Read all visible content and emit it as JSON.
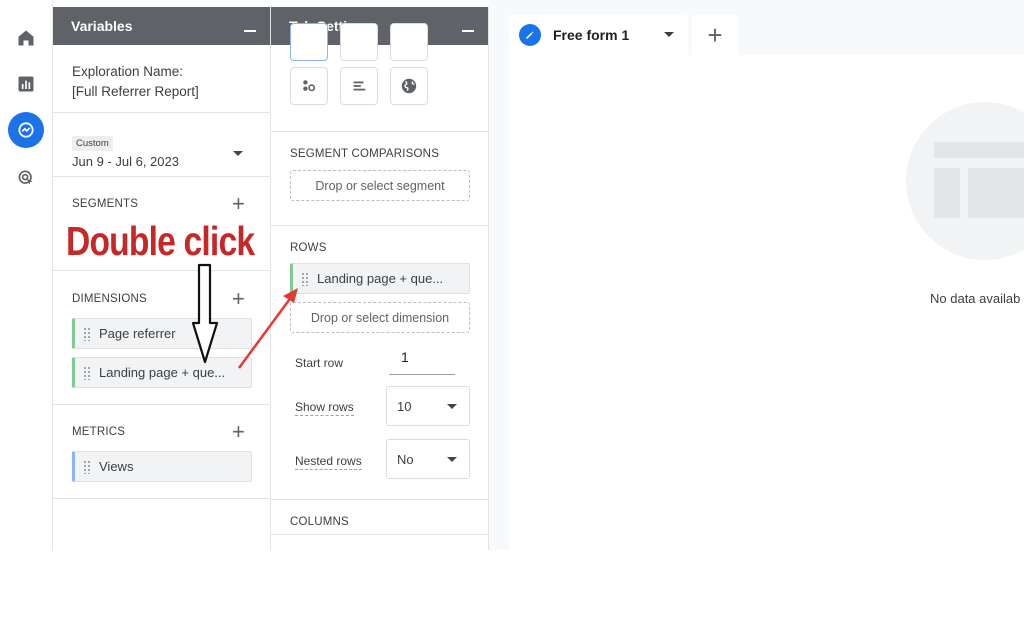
{
  "rail": {
    "items": [
      {
        "icon": "home-icon"
      },
      {
        "icon": "reports-icon"
      },
      {
        "icon": "explore-icon",
        "active": true
      },
      {
        "icon": "advertising-icon"
      }
    ],
    "accent": "#1a73e8"
  },
  "variables": {
    "title": "Variables",
    "exploration_label": "Exploration Name:",
    "exploration_name": "[Full Referrer Report]",
    "date_tag": "Custom",
    "date_range": "Jun 9 - Jul 6, 2023",
    "segments_title": "SEGMENTS",
    "dimensions_title": "DIMENSIONS",
    "dimensions": [
      "Page referrer",
      "Landing page + que..."
    ],
    "metrics_title": "METRICS",
    "metrics": [
      "Views"
    ]
  },
  "tab_settings": {
    "title": "Tab Settings",
    "viz_icons": [
      "scatter-icon",
      "bar-chart-icon",
      "globe-icon"
    ],
    "segment_comparisons_title": "SEGMENT COMPARISONS",
    "segment_drop": "Drop or select segment",
    "rows_title": "ROWS",
    "rows_item": "Landing page + que...",
    "rows_drop": "Drop or select dimension",
    "start_row_label": "Start row",
    "start_row_value": "1",
    "show_rows_label": "Show rows",
    "show_rows_value": "10",
    "nested_rows_label": "Nested rows",
    "nested_rows_value": "No",
    "columns_title": "COLUMNS"
  },
  "canvas": {
    "tab_label": "Free form 1",
    "add_tab": "+",
    "empty_text": "No data availab"
  },
  "annotation": {
    "text": "Double click",
    "color": "#c62828"
  }
}
